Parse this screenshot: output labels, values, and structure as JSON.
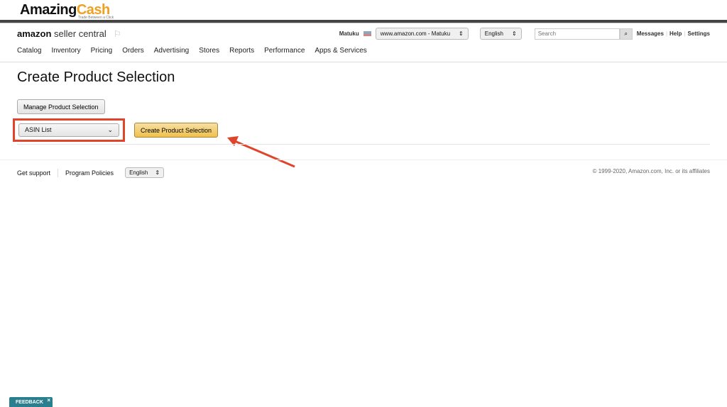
{
  "brand": {
    "part1": "Amazing",
    "part2": "Cash",
    "tagline": "Trade Between a Click"
  },
  "header": {
    "logo_bold": "amazon",
    "logo_rest": " seller central",
    "user": "Matuku",
    "marketplace": "www.amazon.com - Matuku",
    "language": "English",
    "search_placeholder": "Search",
    "links": [
      "Messages",
      "Help",
      "Settings"
    ]
  },
  "nav": [
    "Catalog",
    "Inventory",
    "Pricing",
    "Orders",
    "Advertising",
    "Stores",
    "Reports",
    "Performance",
    "Apps & Services"
  ],
  "page": {
    "title": "Create Product Selection",
    "manage_button": "Manage Product Selection",
    "dropdown_value": "ASIN List",
    "create_button": "Create Product Selection",
    "highlight_color": "#e0442a"
  },
  "footer": {
    "support": "Get support",
    "policies": "Program Policies",
    "language": "English",
    "copyright": "© 1999-2020, Amazon.com, Inc. or its affiliates"
  },
  "feedback": {
    "label": "FEEDBACK",
    "close": "×"
  }
}
